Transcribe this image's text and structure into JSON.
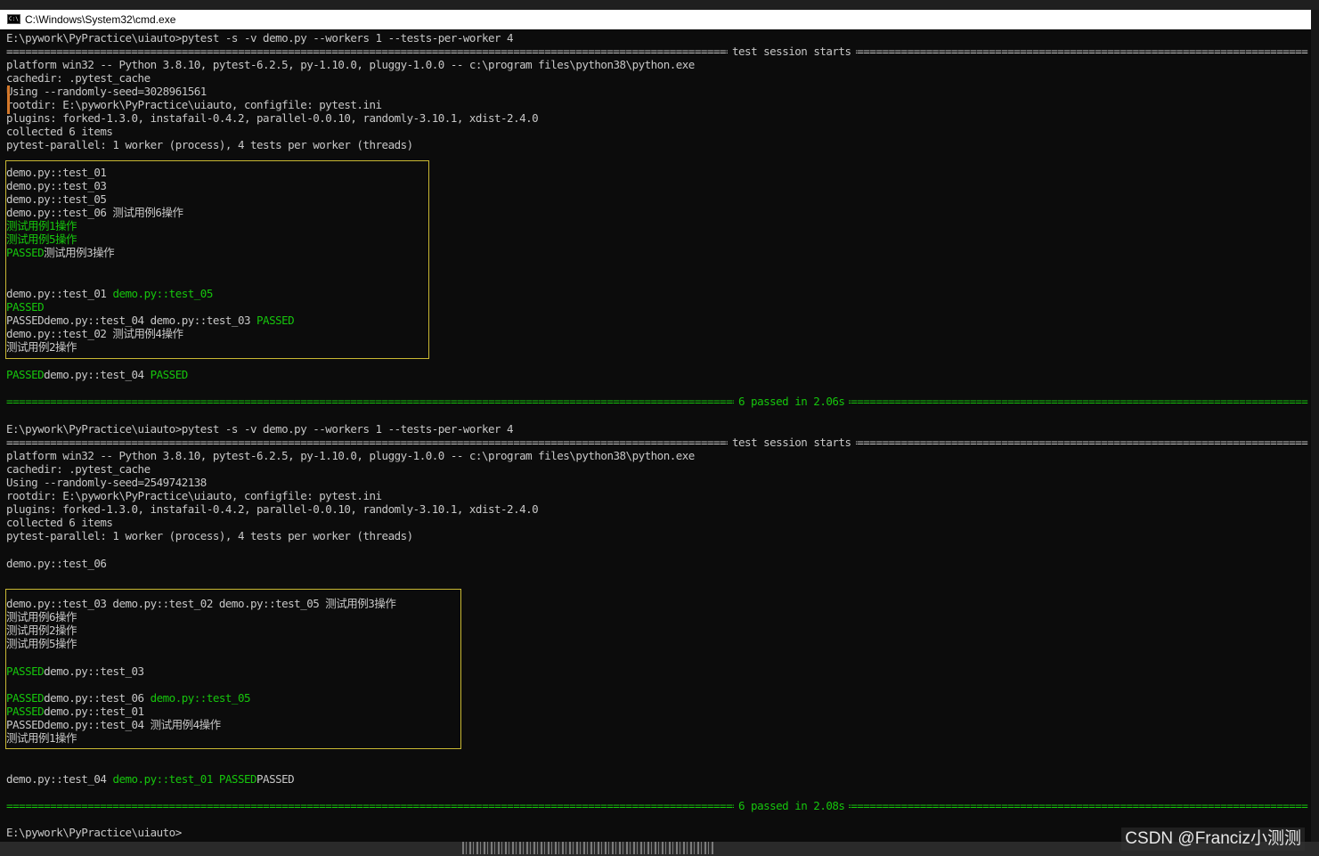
{
  "window": {
    "title": "C:\\Windows\\System32\\cmd.exe",
    "icon": "cmd-icon"
  },
  "colors": {
    "background": "#0c0c0c",
    "text": "#c8c8c8",
    "green": "#16c60c",
    "highlight_box": "#c9b833"
  },
  "run1": {
    "command": "E:\\pywork\\PyPractice\\uiauto>pytest -s -v demo.py --workers 1 --tests-per-worker 4",
    "session_header": "test session starts",
    "platform": "platform win32 -- Python 3.8.10, pytest-6.2.5, py-1.10.0, pluggy-1.0.0 -- c:\\program files\\python38\\python.exe",
    "cachedir": "cachedir: .pytest_cache",
    "seed": "Using --randomly-seed=3028961561",
    "rootdir": "rootdir: E:\\pywork\\PyPractice\\uiauto, configfile: pytest.ini",
    "plugins": "plugins: forked-1.3.0, instafail-0.4.2, parallel-0.0.10, randomly-3.10.1, xdist-2.4.0",
    "collected": "collected 6 items",
    "parallel": "pytest-parallel: 1 worker (process), 4 tests per worker (threads)",
    "out_1": "demo.py::test_01",
    "out_2": "demo.py::test_03",
    "out_3": "demo.py::test_05",
    "out_4": "demo.py::test_06 测试用例6操作",
    "out_5": "测试用例1操作",
    "out_6": "测试用例5操作",
    "out_7a": "PASSED",
    "out_7b": "测试用例3操作",
    "out_8a": "demo.py::test_01 ",
    "out_8b": "demo.py::test_05",
    "out_9": "PASSED",
    "out_10a": "PASSEDdemo.py::test_04 demo.py::test_03 ",
    "out_10b": "PASSED",
    "out_11": "demo.py::test_02 测试用例4操作",
    "out_12": "测试用例2操作",
    "out_13a": "PASSED",
    "out_13b": "demo.py::test_04 ",
    "out_13c": "PASSED",
    "summary": "6 passed in 2.06s"
  },
  "run2": {
    "command": "E:\\pywork\\PyPractice\\uiauto>pytest -s -v demo.py --workers 1 --tests-per-worker 4",
    "session_header": "test session starts",
    "platform": "platform win32 -- Python 3.8.10, pytest-6.2.5, py-1.10.0, pluggy-1.0.0 -- c:\\program files\\python38\\python.exe",
    "cachedir": "cachedir: .pytest_cache",
    "seed": "Using --randomly-seed=2549742138",
    "rootdir": "rootdir: E:\\pywork\\PyPractice\\uiauto, configfile: pytest.ini",
    "plugins": "plugins: forked-1.3.0, instafail-0.4.2, parallel-0.0.10, randomly-3.10.1, xdist-2.4.0",
    "collected": "collected 6 items",
    "parallel": "pytest-parallel: 1 worker (process), 4 tests per worker (threads)",
    "out_0": "demo.py::test_06",
    "out_1": "demo.py::test_03 demo.py::test_02 demo.py::test_05 测试用例3操作",
    "out_2": "测试用例6操作",
    "out_3": "测试用例2操作",
    "out_4": "测试用例5操作",
    "out_5a": "PASSED",
    "out_5b": "demo.py::test_03",
    "out_6a": "PASSED",
    "out_6b": "demo.py::test_06 ",
    "out_6c": "demo.py::test_05",
    "out_7a": "PASSED",
    "out_7b": "demo.py::test_01",
    "out_8": "PASSEDdemo.py::test_04 测试用例4操作",
    "out_9": "测试用例1操作",
    "out_10a": "demo.py::test_04 ",
    "out_10b": "demo.py::test_01 PASSED",
    "out_10c": "PASSED",
    "summary": "6 passed in 2.08s"
  },
  "prompt": "E:\\pywork\\PyPractice\\uiauto>",
  "watermark": "CSDN @Franciz小测测"
}
